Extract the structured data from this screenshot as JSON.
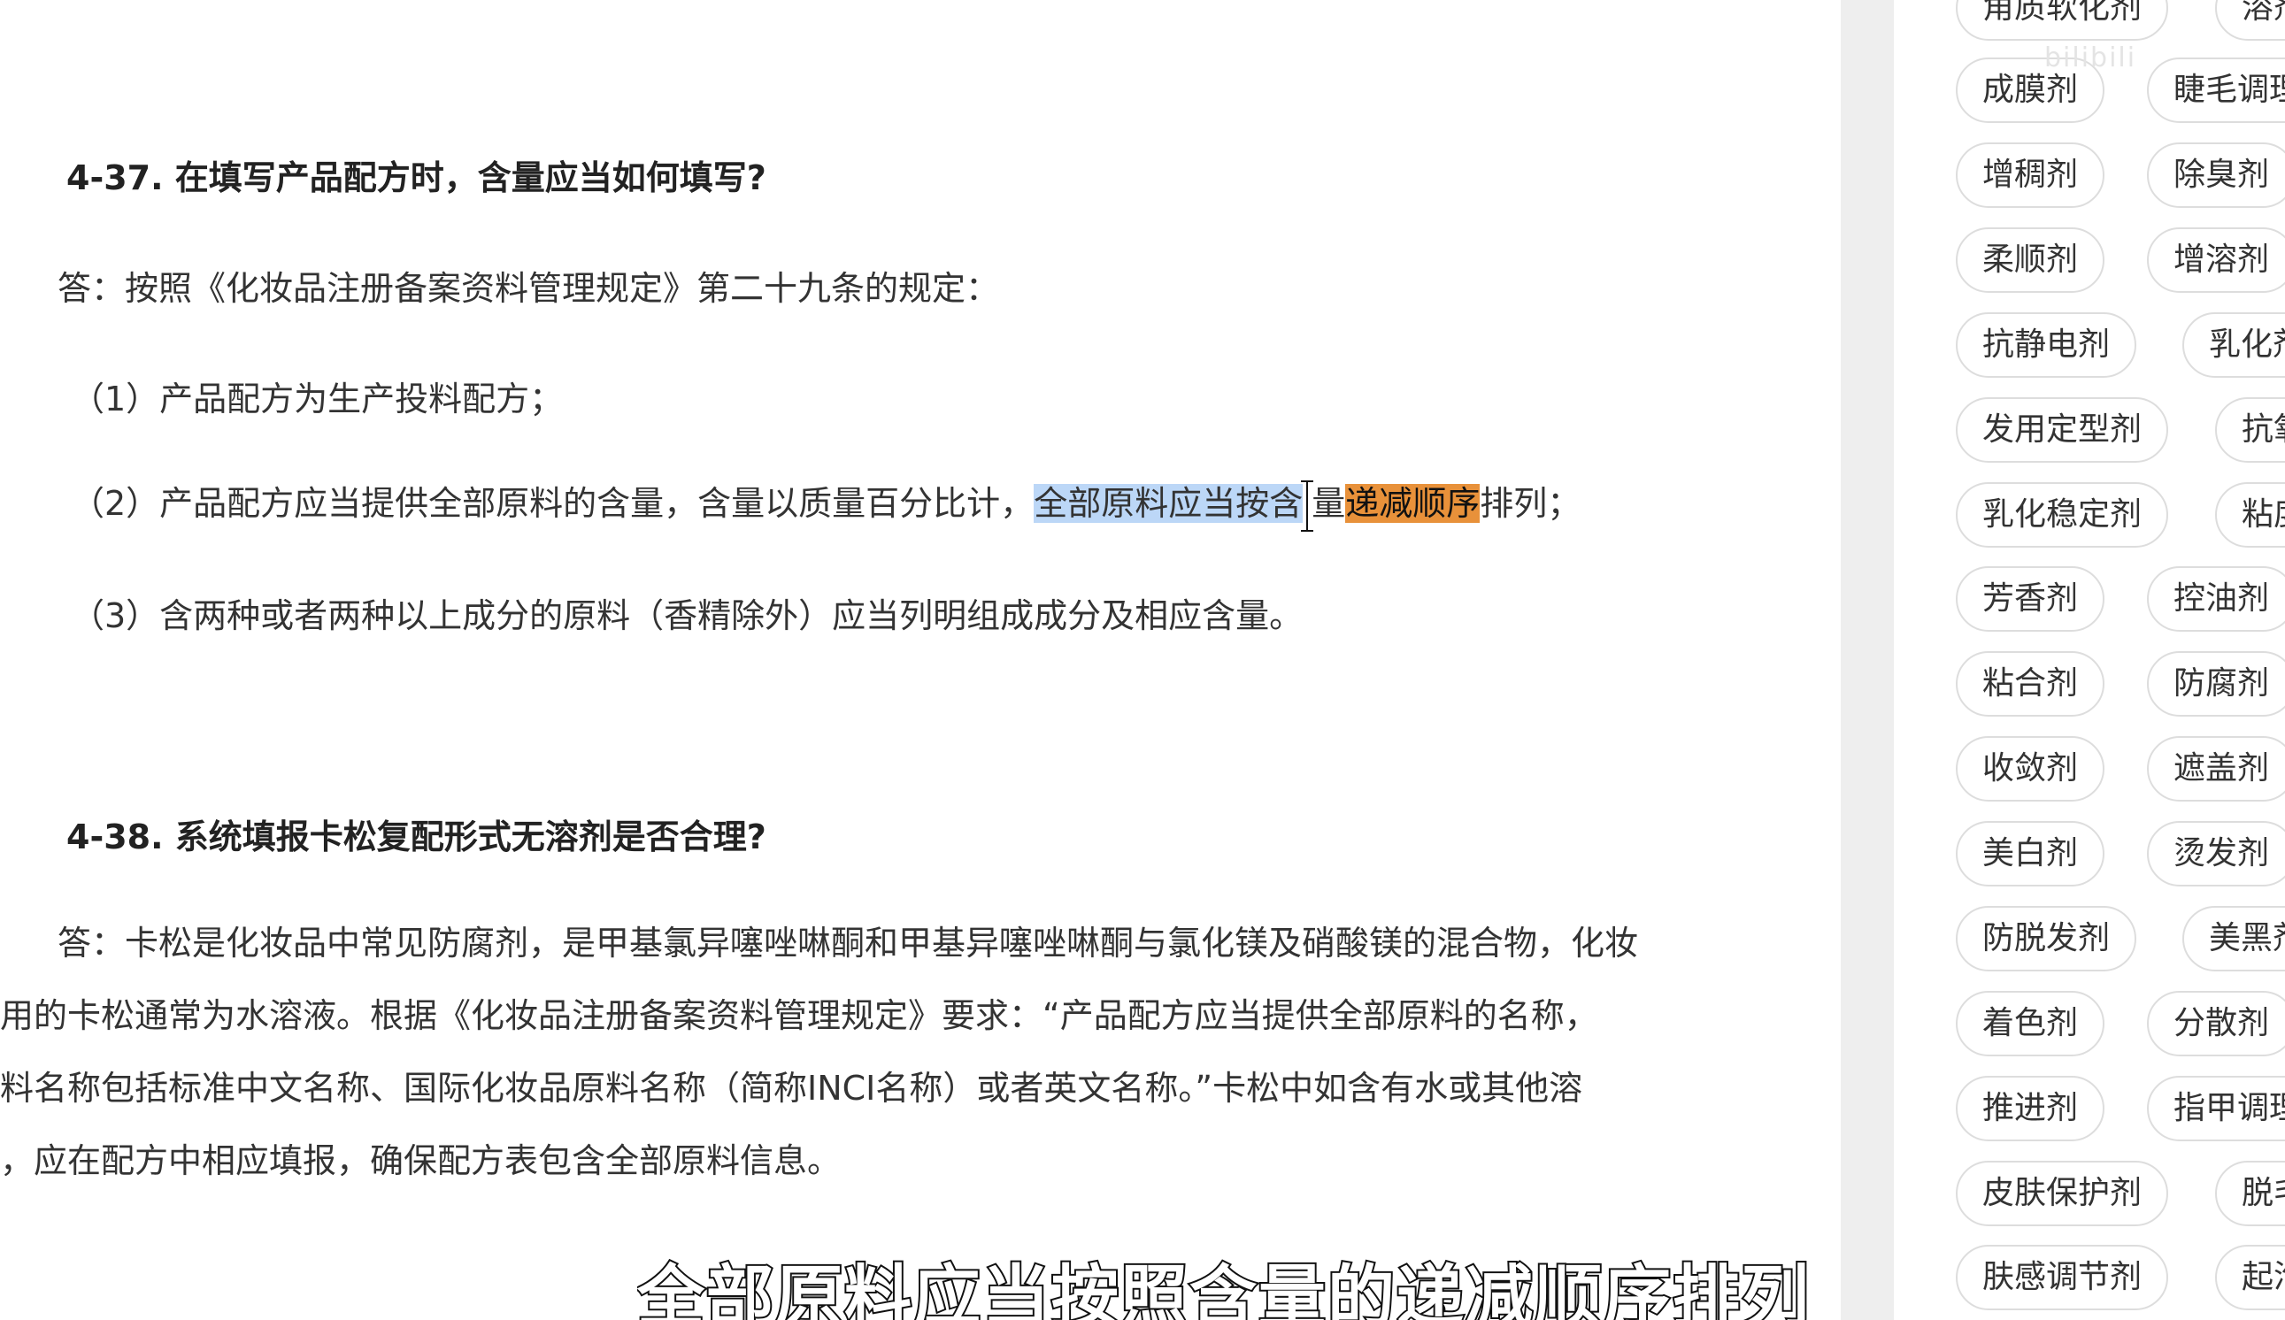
{
  "document": {
    "q1": {
      "heading": "4-37. 在填写产品配方时，含量应当如何填写?",
      "answer": "答：按照《化妆品注册备案资料管理规定》第二十九条的规定：",
      "item1": "（1）产品配方为生产投料配方；",
      "item2_before": "（2）产品配方应当提供全部原料的含量，含量以质量百分比计，",
      "item2_selected": "全部原料应当按含",
      "item2_selected_tail": "量",
      "item2_highlight": "递减顺序",
      "item2_after": "排列；",
      "item3": "（3）含两种或者两种以上成分的原料（香精除外）应当列明组成成分及相应含量。"
    },
    "q2": {
      "heading": "4-38. 系统填报卡松复配形式无溶剂是否合理?",
      "line1": "答：卡松是化妆品中常见防腐剂，是甲基氯异噻唑啉酮和甲基异噻唑啉酮与氯化镁及硝酸镁的混合物，化妆",
      "line2": "品用的卡松通常为水溶液。根据《化妆品注册备案资料管理规定》要求：“产品配方应当提供全部原料的名称，",
      "line3": "原料名称包括标准中文名称、国际化妆品原料名称（简称INCI名称）或者英文名称。”卡松中如含有水或其他溶",
      "line4": "剂，应在配方中相应填报，确保配方表包含全部原料信息。"
    }
  },
  "sidebar": {
    "chips_left": [
      "角质软化剂",
      "成膜剂",
      "增稠剂",
      "柔顺剂",
      "抗静电剂",
      "发用定型剂",
      "乳化稳定剂",
      "芳香剂",
      "粘合剂",
      "收敛剂",
      "美白剂",
      "防脱发剂",
      "着色剂",
      "推进剂",
      "皮肤保护剂",
      "肤感调节剂"
    ],
    "chips_right": [
      "溶剂",
      "睫毛调理剂",
      "除臭剂",
      "增溶剂",
      "乳化剂",
      "抗氧化剂",
      "粘度调节剂",
      "控油剂",
      "防腐剂",
      "遮盖剂",
      "烫发剂",
      "美黑剂",
      "分散剂",
      "指甲调理剂",
      "脱毛剂",
      "起泡剂"
    ]
  },
  "watermark": "bilibili",
  "subtitle": "全部原料应当按照含量的递减顺序排列"
}
